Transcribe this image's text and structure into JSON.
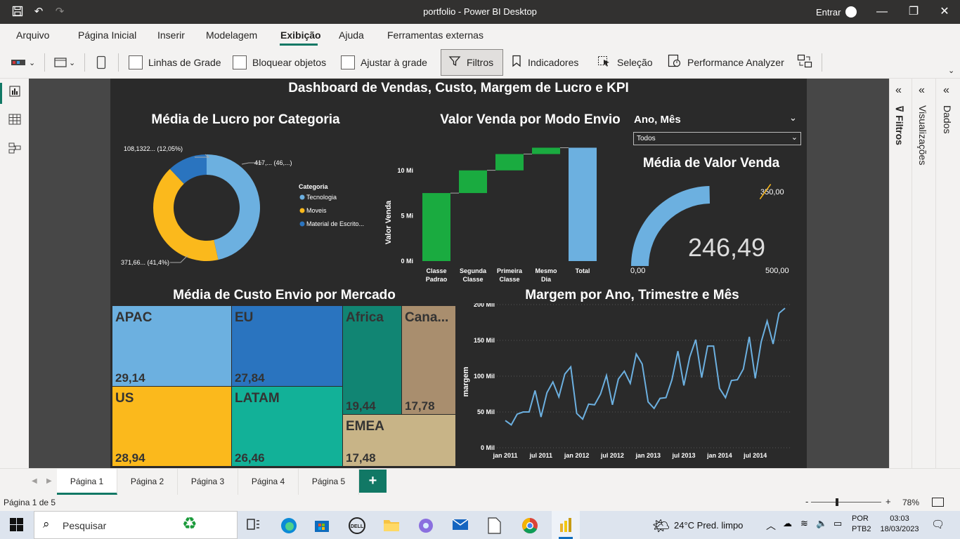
{
  "window": {
    "title": "portfolio - Power BI Desktop",
    "signin": "Entrar"
  },
  "menu": [
    "Arquivo",
    "Página Inicial",
    "Inserir",
    "Modelagem",
    "Exibição",
    "Ajuda",
    "Ferramentas externas"
  ],
  "ribbon": {
    "gridlines": "Linhas de Grade",
    "lock": "Bloquear objetos",
    "snap": "Ajustar à grade",
    "filters": "Filtros",
    "bookmarks": "Indicadores",
    "selection": "Seleção",
    "performance": "Performance Analyzer"
  },
  "report": {
    "title": "Dashboard de Vendas, Custo, Margem de Lucro e KPI",
    "donut": {
      "title": "Média de Lucro por Categoria",
      "legend_title": "Categoria",
      "label_top_left": "108,1322... (12,05%)",
      "label_top_right": "417,... (46,...)",
      "label_bottom": "371,66... (41,4%)"
    },
    "waterfall": {
      "title": "Valor Venda por Modo Envio",
      "ylabel": "Valor Venda"
    },
    "slicer": {
      "title": "Ano, Mês",
      "value": "Todos"
    },
    "gauge": {
      "title": "Média de Valor Venda",
      "value": "246,49",
      "min": "0,00",
      "max": "500,00",
      "target": "350,00"
    },
    "treemap": {
      "title": "Média de Custo Envio por Mercado"
    },
    "line": {
      "title": "Margem por Ano, Trimestre e Mês",
      "ylabel": "margem"
    }
  },
  "chart_data": [
    {
      "type": "pie",
      "title": "Média de Lucro por Categoria",
      "legend_title": "Categoria",
      "categories": [
        "Tecnologia",
        "Moveis",
        "Material de Escrito..."
      ],
      "values": [
        417,
        371.66,
        108.1322
      ],
      "percent": [
        46.5,
        41.4,
        12.05
      ],
      "colors": [
        "#6cb0e0",
        "#fbb91c",
        "#2a74bf"
      ]
    },
    {
      "type": "bar",
      "subtype": "waterfall",
      "title": "Valor Venda por Modo Envio",
      "ylabel": "Valor Venda",
      "categories": [
        "Classe Padrao",
        "Segunda Classe",
        "Primeira Classe",
        "Mesmo Dia",
        "Total"
      ],
      "category_lines": [
        [
          "Classe",
          "Padrao"
        ],
        [
          "Segunda",
          "Classe"
        ],
        [
          "Primeira",
          "Classe"
        ],
        [
          "Mesmo",
          "Dia"
        ],
        [
          "Total"
        ]
      ],
      "values": [
        7.5,
        2.5,
        1.8,
        0.7,
        12.5
      ],
      "units": "Mi",
      "yticks": [
        0,
        5,
        10
      ],
      "ytick_labels": [
        "0 Mi",
        "5 Mi",
        "10 Mi"
      ],
      "ylim": [
        0,
        13
      ],
      "colors": {
        "increase": "#1aab40",
        "total": "#6cb0e0"
      }
    },
    {
      "type": "gauge",
      "title": "Média de Valor Venda",
      "value": 246.49,
      "min": 0,
      "max": 500,
      "target": 350
    },
    {
      "type": "treemap",
      "title": "Média de Custo Envio por Mercado",
      "items": [
        {
          "name": "APAC",
          "value": "29,14",
          "color": "#6cb0e0"
        },
        {
          "name": "EU",
          "value": "27,84",
          "color": "#2a74bf"
        },
        {
          "name": "Africa",
          "value": "19,44",
          "color": "#118573"
        },
        {
          "name": "Cana...",
          "value": "17,78",
          "color": "#a98e6e"
        },
        {
          "name": "US",
          "value": "28,94",
          "color": "#fbb91c"
        },
        {
          "name": "LATAM",
          "value": "26,46",
          "color": "#12b198"
        },
        {
          "name": "EMEA",
          "value": "17,48",
          "color": "#c8b487"
        }
      ]
    },
    {
      "type": "line",
      "title": "Margem por Ano, Trimestre e Mês",
      "ylabel": "margem",
      "ylim": [
        0,
        200
      ],
      "yticks": [
        0,
        50,
        100,
        150,
        200
      ],
      "ytick_labels": [
        "0 Mil",
        "50 Mil",
        "100 Mil",
        "150 Mil",
        "200 Mil"
      ],
      "xtick_labels": [
        "jan 2011",
        "jul 2011",
        "jan 2012",
        "jul 2012",
        "jan 2013",
        "jul 2013",
        "jan 2014",
        "jul 2014"
      ],
      "units": "Mil",
      "values": [
        38,
        32,
        47,
        50,
        50,
        80,
        43,
        77,
        92,
        71,
        103,
        113,
        48,
        40,
        61,
        60,
        75,
        101,
        60,
        96,
        107,
        90,
        131,
        117,
        64,
        55,
        69,
        70,
        95,
        135,
        87,
        127,
        151,
        98,
        142,
        142,
        83,
        70,
        94,
        95,
        110,
        155,
        97,
        148,
        177,
        145,
        188,
        195
      ],
      "color": "#6cb0e0"
    }
  ],
  "tabs": [
    "Página 1",
    "Página 2",
    "Página 3",
    "Página 4",
    "Página 5"
  ],
  "status": {
    "page": "Página 1 de 5",
    "zoom": "78%"
  },
  "taskbar": {
    "search": "Pesquisar",
    "weather": "24°C  Pred. limpo",
    "lang1": "POR",
    "lang2": "PTB2",
    "time": "03:03",
    "date": "18/03/2023"
  },
  "panes": {
    "filters": "Filtros",
    "visualizations": "Visualizações",
    "data": "Dados"
  }
}
